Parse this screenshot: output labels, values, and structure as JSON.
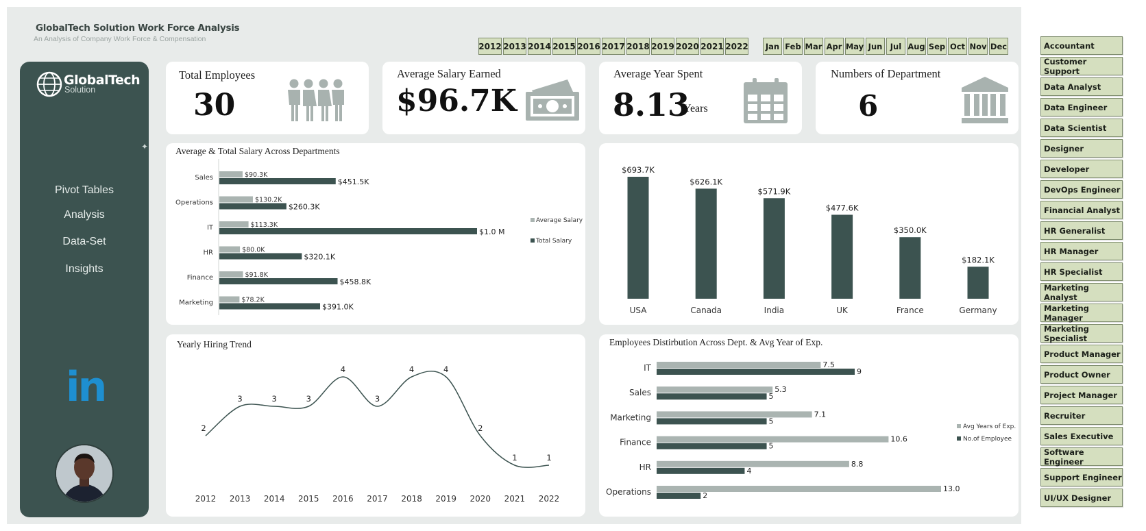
{
  "header": {
    "title": "GlobalTech Solution Work Force Analysis",
    "subtitle": "An Analysis of Company Work Force & Compensation"
  },
  "years": [
    "2012",
    "2013",
    "2014",
    "2015",
    "2016",
    "2017",
    "2018",
    "2019",
    "2020",
    "2021",
    "2022"
  ],
  "months": [
    "Jan",
    "Feb",
    "Mar",
    "Apr",
    "May",
    "Jun",
    "Jul",
    "Aug",
    "Sep",
    "Oct",
    "Nov",
    "Dec"
  ],
  "job_titles": [
    "Accountant",
    "Customer Support",
    "Data Analyst",
    "Data Engineer",
    "Data Scientist",
    "Designer",
    "Developer",
    "DevOps Engineer",
    "Financial Analyst",
    "HR Generalist",
    "HR Manager",
    "HR Specialist",
    "Marketing Analyst",
    "Marketing Manager",
    "Marketing Specialist",
    "Product Manager",
    "Product Owner",
    "Project Manager",
    "Recruiter",
    "Sales Executive",
    "Software Engineer",
    "Support Engineer",
    "UI/UX Designer"
  ],
  "sidebar": {
    "logo_name": "GlobalTech",
    "logo_sub": "Solution",
    "nav": [
      "Pivot Tables",
      "Analysis",
      "Data-Set",
      "Insights"
    ],
    "linkedin": "in"
  },
  "kpis": {
    "total_employees": {
      "label": "Total Employees",
      "value": "30"
    },
    "avg_salary": {
      "label": "Average Salary Earned",
      "value": "$96.7K"
    },
    "avg_years": {
      "label": "Average Year Spent",
      "value": "8.13",
      "unit": "Years"
    },
    "departments": {
      "label": "Numbers of Department",
      "value": "6"
    }
  },
  "colors": {
    "dark": "#3c5350",
    "light": "#aab4b1",
    "accent": "#1e8fd0"
  },
  "chart_data": [
    {
      "type": "bar",
      "orientation": "horizontal",
      "title": "Average & Total Salary Across Departments",
      "categories": [
        "Sales",
        "Operations",
        "IT",
        "HR",
        "Finance",
        "Marketing"
      ],
      "series": [
        {
          "name": "Average Salary",
          "values": [
            90.3,
            130.2,
            113.3,
            80.0,
            91.8,
            78.2
          ],
          "labels": [
            "$90.3K",
            "$130.2K",
            "$113.3K",
            "$80.0K",
            "$91.8K",
            "$78.2K"
          ]
        },
        {
          "name": "Total Salary",
          "values": [
            451.5,
            260.3,
            1000,
            320.1,
            458.8,
            391.0
          ],
          "labels": [
            "$451.5K",
            "$260.3K",
            "$1.0 M",
            "$320.1K",
            "$458.8K",
            "$391.0K"
          ]
        }
      ],
      "legend": "right"
    },
    {
      "type": "bar",
      "title": "",
      "categories": [
        "USA",
        "Canada",
        "India",
        "UK",
        "France",
        "Germany"
      ],
      "values": [
        693.7,
        626.1,
        571.9,
        477.6,
        350.0,
        182.1
      ],
      "labels": [
        "$693.7K",
        "$626.1K",
        "$571.9K",
        "$477.6K",
        "$350.0K",
        "$182.1K"
      ]
    },
    {
      "type": "line",
      "title": "Yearly Hiring Trend",
      "x": [
        "2012",
        "2013",
        "2014",
        "2015",
        "2016",
        "2017",
        "2018",
        "2019",
        "2020",
        "2021",
        "2022"
      ],
      "values": [
        2,
        3,
        3,
        3,
        4,
        3,
        4,
        4,
        2,
        1,
        1
      ]
    },
    {
      "type": "bar",
      "orientation": "horizontal",
      "title": "Employees Distirbution Across Dept. & Avg Year of Exp.",
      "categories": [
        "IT",
        "Sales",
        "Marketing",
        "Finance",
        "HR",
        "Operations"
      ],
      "series": [
        {
          "name": "Avg Years of Exp.",
          "values": [
            7.5,
            5.3,
            7.1,
            10.6,
            8.8,
            13.0
          ],
          "labels": [
            "7.5",
            "5.3",
            "7.1",
            "10.6",
            "8.8",
            "13.0"
          ]
        },
        {
          "name": "No.of Employee",
          "values": [
            9,
            5,
            5,
            5,
            4,
            2
          ],
          "labels": [
            "9",
            "5",
            "5",
            "5",
            "4",
            "2"
          ]
        }
      ],
      "legend": "right"
    }
  ]
}
